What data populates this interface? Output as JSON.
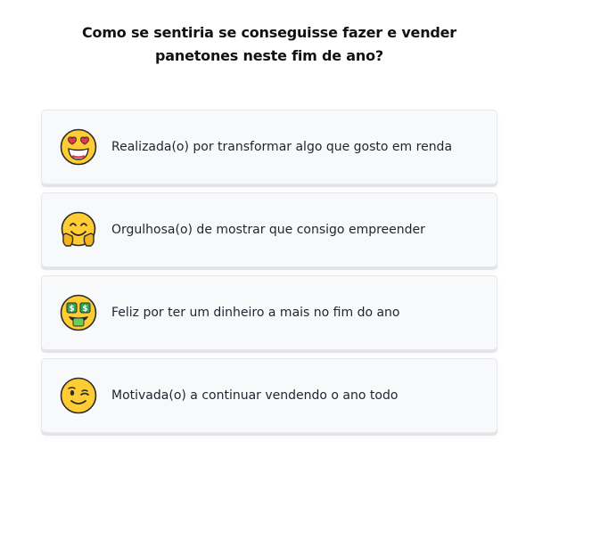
{
  "question": "Como se sentiria se conseguisse fazer e vender panetones neste fim de ano?",
  "options": [
    {
      "label": "Realizada(o) por transformar algo que gosto em renda",
      "icon": "heart-eyes-face-icon"
    },
    {
      "label": "Orgulhosa(o) de mostrar que consigo empreender",
      "icon": "hugging-face-icon"
    },
    {
      "label": "Feliz por ter um dinheiro a mais no fim do ano",
      "icon": "money-mouth-face-icon"
    },
    {
      "label": "Motivada(o) a continuar vendendo o ano todo",
      "icon": "winking-face-icon"
    }
  ],
  "colors": {
    "face": "#FFCC33",
    "face_outline": "#E8A317",
    "heart": "#E8344E",
    "money": "#2FA84F",
    "card_bg": "#F8F9FB",
    "card_border": "#E6E8EC"
  }
}
